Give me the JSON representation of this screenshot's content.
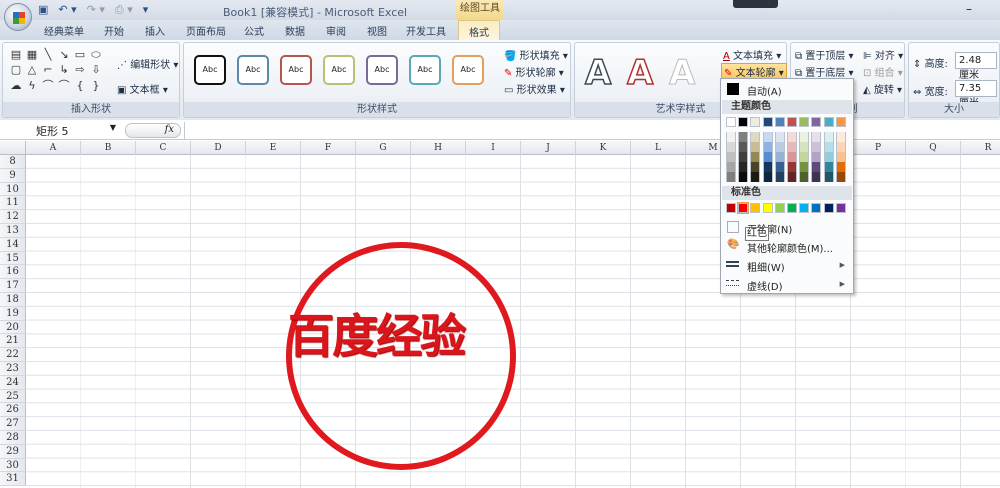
{
  "window": {
    "title": "Book1  [兼容模式] - Microsoft Excel",
    "context_tab_group": "绘图工具",
    "minimize": "–",
    "help": "?"
  },
  "qat": {
    "save": "▣",
    "undo": "↶ ▾",
    "redo": "↷ ▾",
    "print": "⎙ ▾",
    "customize": "▾"
  },
  "tabs": [
    "经典菜单",
    "开始",
    "插入",
    "页面布局",
    "公式",
    "数据",
    "审阅",
    "视图",
    "开发工具",
    "格式"
  ],
  "active_tab": "格式",
  "ribbon": {
    "insert_shapes": {
      "label": "插入形状",
      "edit_shape": "编辑形状 ▾",
      "text_box": "文本框 ▾",
      "shapes": [
        "▤",
        "▦",
        "╲",
        "↘",
        "▭",
        "⬭",
        "▢",
        "△",
        "⌐",
        "↳",
        "⇨",
        "⇩",
        "☁",
        "ϟ",
        "⌒",
        "⌒",
        "{",
        "}"
      ]
    },
    "shape_styles": {
      "label": "形状样式",
      "sample": "Abc",
      "style_colors": [
        "#111111",
        "#5b8aa8",
        "#b85450",
        "#b7c07a",
        "#7a6a96",
        "#5aaab5",
        "#e0a060"
      ],
      "fill": "形状填充 ▾",
      "outline": "形状轮廓 ▾",
      "effects": "形状效果 ▾"
    },
    "wordart_styles": {
      "label": "艺术字样式",
      "sample": "A",
      "text_fill": "文本填充 ▾",
      "text_outline": "文本轮廓 ▾"
    },
    "arrange": {
      "label": "排列",
      "bring_front": "置于顶层 ▾",
      "send_back": "置于底层 ▾",
      "align": "对齐 ▾",
      "group": "组合 ▾",
      "rotate": "旋转 ▾"
    },
    "size": {
      "label": "大小",
      "height_label": "高度:",
      "height_value": "2.48 厘米",
      "width_label": "宽度:",
      "width_value": "7.35 厘米"
    }
  },
  "formula_bar": {
    "name_box": "矩形 5",
    "fx": "fx",
    "formula": ""
  },
  "columns": [
    "A",
    "B",
    "C",
    "D",
    "E",
    "F",
    "G",
    "H",
    "I",
    "J",
    "K",
    "L",
    "M",
    "N",
    "O",
    "P",
    "Q",
    "R"
  ],
  "rows": [
    "8",
    "9",
    "10",
    "11",
    "12",
    "13",
    "14",
    "15",
    "16",
    "17",
    "18",
    "19",
    "20",
    "21",
    "22",
    "23",
    "24",
    "25",
    "26",
    "27",
    "28",
    "29",
    "30",
    "31"
  ],
  "stamp": {
    "text": "百度经验",
    "color": "#e0191e"
  },
  "outline_menu": {
    "automatic": "自动(A)",
    "theme_colors_label": "主题颜色",
    "theme_colors": [
      "#ffffff",
      "#000000",
      "#eeece1",
      "#1f497d",
      "#4f81bd",
      "#c0504d",
      "#9bbb59",
      "#8064a2",
      "#4bacc6",
      "#f79646"
    ],
    "theme_shades": [
      [
        "#f2f2f2",
        "#7f7f7f",
        "#ddd9c3",
        "#c6d9f0",
        "#dbe5f1",
        "#f2dcdb",
        "#ebf1dd",
        "#e5e0ec",
        "#dbeef3",
        "#fdeada"
      ],
      [
        "#d8d8d8",
        "#595959",
        "#c4bd97",
        "#8db3e2",
        "#b8cce4",
        "#e5b9b7",
        "#d7e3bc",
        "#ccc1d9",
        "#b7dde8",
        "#fbd5b5"
      ],
      [
        "#bfbfbf",
        "#3f3f3f",
        "#938953",
        "#548dd4",
        "#95b3d7",
        "#d99694",
        "#c3d69b",
        "#b2a2c7",
        "#92cddc",
        "#fac08f"
      ],
      [
        "#a5a5a5",
        "#262626",
        "#494429",
        "#17365d",
        "#366092",
        "#953734",
        "#76923c",
        "#5f497a",
        "#31859b",
        "#e36c09"
      ],
      [
        "#7f7f7f",
        "#0c0c0c",
        "#1d1b10",
        "#0f243e",
        "#244061",
        "#632423",
        "#4f6128",
        "#3f3151",
        "#205867",
        "#974806"
      ]
    ],
    "standard_colors_label": "标准色",
    "standard_colors": [
      "#c00000",
      "#ff0000",
      "#ffc000",
      "#ffff00",
      "#92d050",
      "#00b050",
      "#00b0f0",
      "#0070c0",
      "#002060",
      "#7030a0"
    ],
    "no_outline": "无轮廓(N)",
    "more_colors": "其他轮廓颜色(M)...",
    "weight": "粗细(W)",
    "dashes": "虚线(D)",
    "tooltip": "红色"
  }
}
